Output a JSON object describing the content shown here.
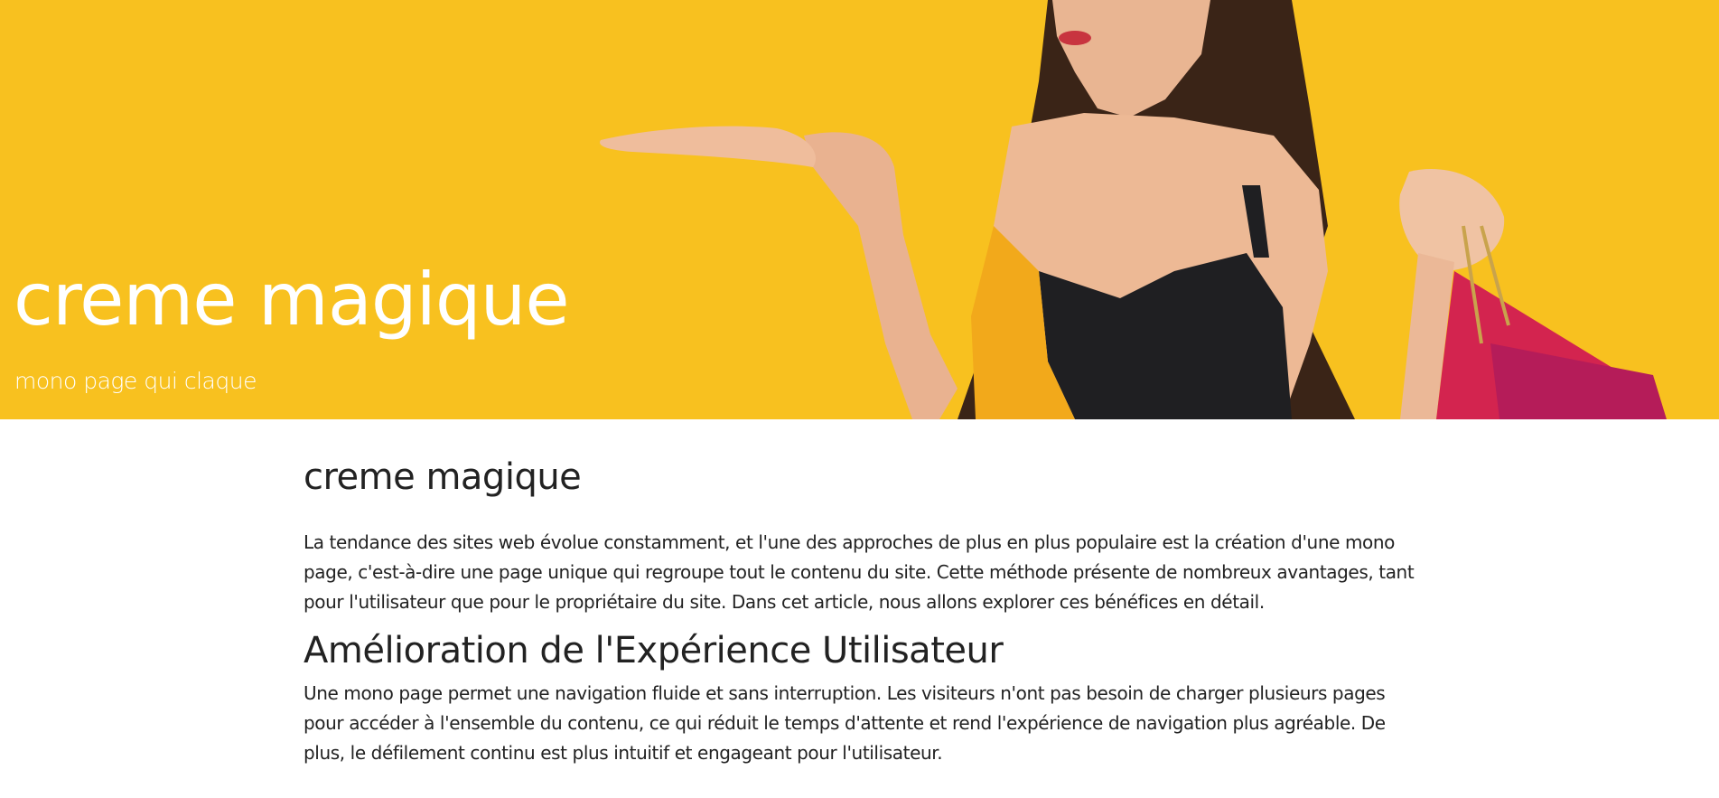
{
  "hero": {
    "title": "creme magique",
    "subtitle": "mono page qui claque",
    "background_color": "#f8c11f"
  },
  "article": {
    "heading": "creme magique",
    "intro": "La tendance des sites web évolue constamment, et l'une des approches de plus en plus populaire est la création d'une mono page, c'est-à-dire une page unique qui regroupe tout le contenu du site. Cette méthode présente de nombreux avantages, tant pour l'utilisateur que pour le propriétaire du site. Dans cet article, nous allons explorer ces bénéfices en détail.",
    "sections": [
      {
        "title": "Amélioration de l'Expérience Utilisateur",
        "text": "Une mono page permet une navigation fluide et sans interruption. Les visiteurs n'ont pas besoin de charger plusieurs pages pour accéder à l'ensemble du contenu, ce qui réduit le temps d'attente et rend l'expérience de navigation plus agréable. De plus, le défilement continu est plus intuitif et engageant pour l'utilisateur."
      }
    ]
  }
}
